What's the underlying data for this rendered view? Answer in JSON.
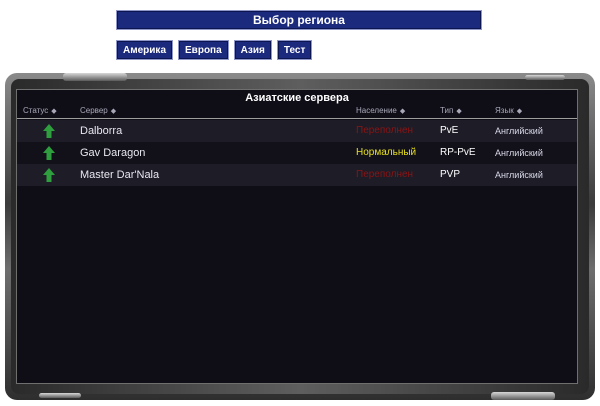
{
  "header": {
    "title": "Выбор региона"
  },
  "tabs": [
    {
      "label": "Америка"
    },
    {
      "label": "Европа"
    },
    {
      "label": "Азия"
    },
    {
      "label": "Тест"
    }
  ],
  "panel": {
    "title": "Азиатские сервера",
    "columns": {
      "status": "Статус",
      "server": "Сервер",
      "population": "Население",
      "type": "Тип",
      "language": "Язык"
    },
    "rows": [
      {
        "name": "Dalborra",
        "population": "Переполнен",
        "population_color": "#8b1414",
        "type": "PvE",
        "language": "Английский",
        "status_icon": "up-arrow-icon"
      },
      {
        "name": "Gav Daragon",
        "population": "Нормальный",
        "population_color": "#e8e020",
        "type": "RP-PvE",
        "language": "Английский",
        "status_icon": "up-arrow-icon"
      },
      {
        "name": "Master Dar'Nala",
        "population": "Переполнен",
        "population_color": "#8b1414",
        "type": "PVP",
        "language": "Английский",
        "status_icon": "up-arrow-icon"
      }
    ]
  },
  "colors": {
    "tab_bg": "#1c2a7e",
    "panel_bg": "#0f0e17",
    "status_up": "#2e9e3e"
  }
}
